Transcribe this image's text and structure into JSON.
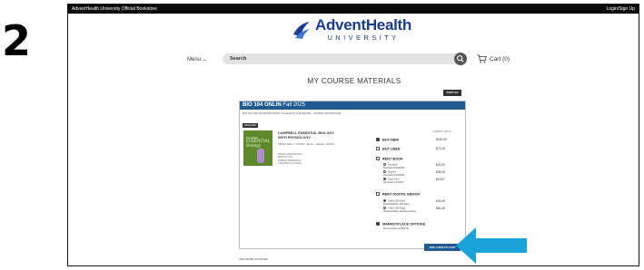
{
  "step_number": "2",
  "topbar": {
    "left": "AdventHealth University Official Bookstore",
    "right": "Login/Sign Up"
  },
  "logo": {
    "line1": "AdventHealth",
    "line2": "UNIVERSITY"
  },
  "nav": {
    "menu": "Menu",
    "menu_icon": "chevron-down-icon",
    "search_placeholder": "Search",
    "cart": "Cart (0)"
  },
  "page": {
    "title": "MY COURSE MATERIALS",
    "sort": "SORT BY"
  },
  "course": {
    "code": "BIO 104 ONLIN",
    "term": "Fall 2025",
    "subtitle": "BIO 104 ONLIN HUMAN BODY IN HEALTH & DISEASE · LIANNE GRANDHOLE",
    "required_badge": "REQUIRED"
  },
  "book": {
    "cover_line1": "Campbell",
    "cover_line2": "ESSENTIAL Biology",
    "title": "CAMPBELL ESSENTIAL BIOLOGY WITH PHYSIOLOGY",
    "authors": "SIMON, ERIC J., DICKEY, JEAN L., REECE, JANE B.",
    "meta": [
      "ISBN13: 9780135167021",
      "EDITION: 6TH",
      "FORMAT: PAPERBACK",
      "COPYRIGHT: 2/10/2020"
    ]
  },
  "options": {
    "current_price_label": "CURRENT PRICE",
    "buy_new": {
      "label": "BUY NEW",
      "price": "$169.95"
    },
    "buy_used": {
      "label": "BUY USED",
      "price": "$73.15"
    },
    "rent_book": {
      "label": "RENT BOOK",
      "items": [
        {
          "name": "Semester",
          "due": "Due back 8/13/2025",
          "price": "$20.30"
        },
        {
          "name": "Quarter",
          "due": "Due back 6/10/2025",
          "price": "$28.05"
        },
        {
          "name": "Short Term",
          "due": "Due back 1/7/2025",
          "price": "$16.57"
        }
      ]
    },
    "rent_digital": {
      "label": "RENT DIGITAL EBOOK",
      "items": [
        {
          "name": "Online 180 Days",
          "note": "Downloadable: 180 Days",
          "price": "$49.49"
        },
        {
          "name": "Online 365 Days",
          "note": "Downloadable: Lifetime Access",
          "price": "$60.49"
        }
      ]
    },
    "marketplace": {
      "label": "MARKETPLACE OPTIONS",
      "note": "Prices starting at $45.00"
    }
  },
  "add_to_cart": "ADD 1 ITEM TO CART",
  "add_more": "ADD MORE COURSES",
  "colors": {
    "brand_blue": "#1f5a93",
    "arrow": "#1aa3d8",
    "topbar": "#0b0b0b"
  }
}
